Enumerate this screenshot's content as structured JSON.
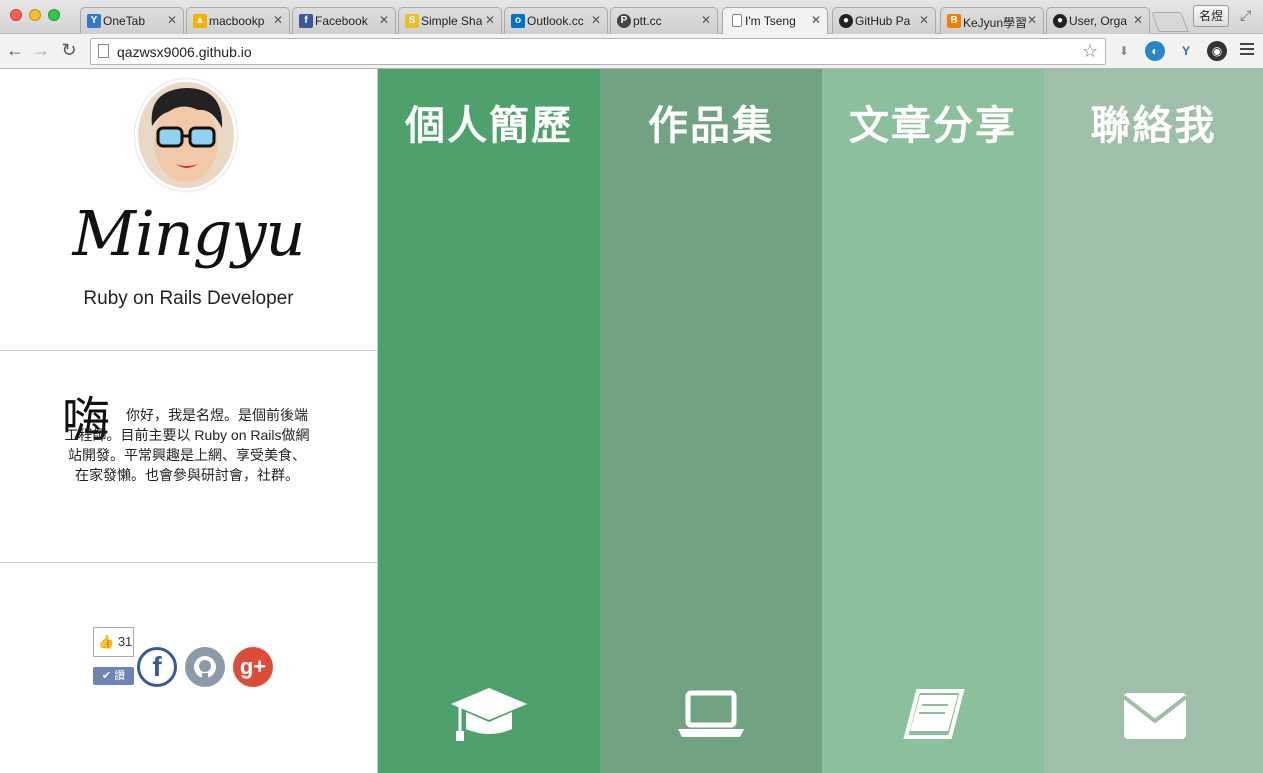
{
  "browser": {
    "tabs": [
      {
        "title": "OneTab",
        "icon": "onetab-icon",
        "color": "#3478c6"
      },
      {
        "title": "macbookp",
        "icon": "google-drive-icon",
        "color": "#f3b300"
      },
      {
        "title": "Facebook",
        "icon": "facebook-icon",
        "color": "#3b5998"
      },
      {
        "title": "Simple Sha",
        "icon": "simple-icon",
        "color": "#e9c02c"
      },
      {
        "title": "Outlook.cc",
        "icon": "outlook-icon",
        "color": "#0072c6"
      },
      {
        "title": "ptt.cc",
        "icon": "ptt-icon",
        "color": "#444444"
      },
      {
        "title": "I'm Tseng",
        "icon": "page-icon",
        "color": "#ffffff"
      },
      {
        "title": "GitHub Pa",
        "icon": "github-icon",
        "color": "#222222"
      },
      {
        "title": "KeJyun學習",
        "icon": "blogger-icon",
        "color": "#f57d00"
      },
      {
        "title": "User, Orga",
        "icon": "github-icon",
        "color": "#222222"
      }
    ],
    "profile_name": "名煜",
    "url": "qazwsx9006.github.io"
  },
  "sidebar": {
    "name": "Mingyu",
    "subtitle": "Ruby on Rails Developer",
    "about_big": "嗨",
    "about_text": "你好，我是名煜。是個前後端工程師。目前主要以 Ruby on Rails做網站開發。平常興趣是上網、享受美食、在家發懶。也會參與研討會，社群。",
    "like_count": "31",
    "like_label": "讚"
  },
  "panels": [
    {
      "title": "個人簡歷",
      "icon": "graduation-cap-icon",
      "color": "#4ea16a"
    },
    {
      "title": "作品集",
      "icon": "laptop-icon",
      "color": "#71a383"
    },
    {
      "title": "文章分享",
      "icon": "book-icon",
      "color": "#8cbf9b"
    },
    {
      "title": "聯絡我",
      "icon": "envelope-icon",
      "color": "#9fbfa9"
    }
  ],
  "colors": {
    "facebook": "#3b5998",
    "github": "#8a9aa8",
    "google_plus": "#dd4b39"
  }
}
